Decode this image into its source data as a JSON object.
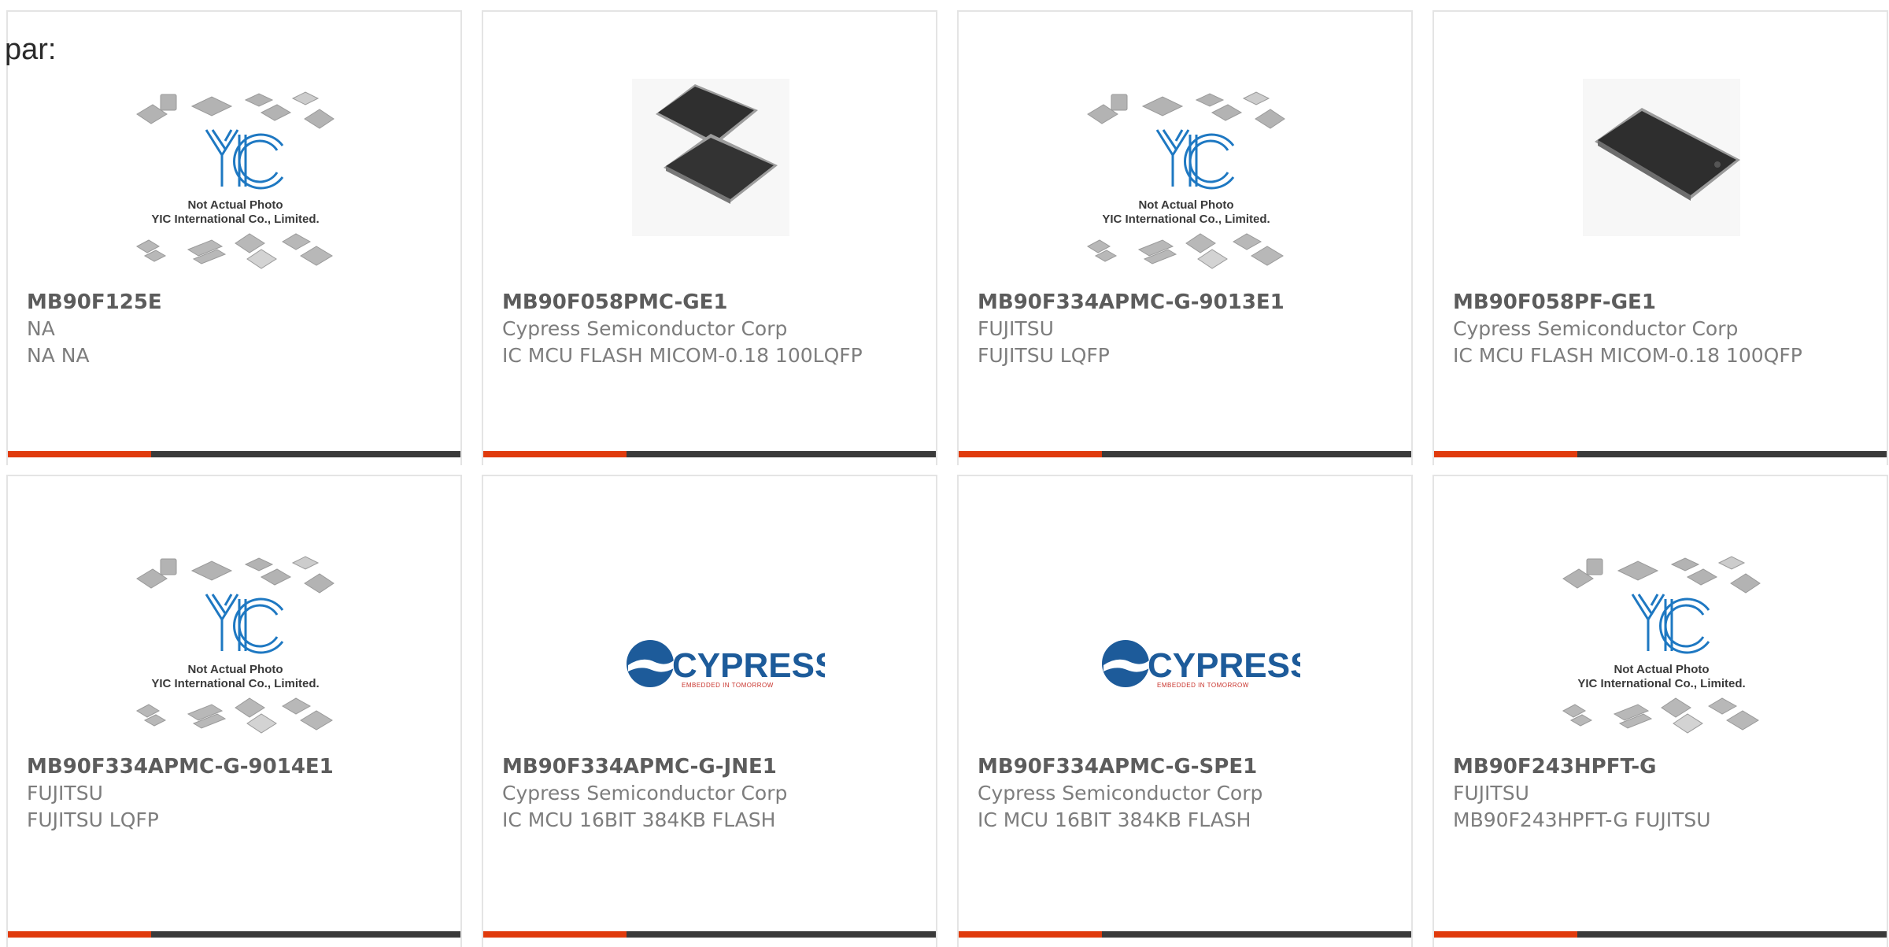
{
  "page": {
    "label": "par:"
  },
  "colors": {
    "accent": "#e03a0c",
    "bar_dark": "#3a3a3a",
    "border": "#e4e4e4"
  },
  "cards": [
    {
      "image": "yic-placeholder",
      "part": "MB90F125E",
      "manufacturer": "NA",
      "description": "NA NA",
      "note1": "Not Actual Photo",
      "note2": "YIC International Co., Limited."
    },
    {
      "image": "chip-pair-photo",
      "part": "MB90F058PMC-GE1",
      "manufacturer": "Cypress Semiconductor Corp",
      "description": "IC MCU FLASH MICOM-0.18 100LQFP"
    },
    {
      "image": "yic-placeholder",
      "part": "MB90F334APMC-G-9013E1",
      "manufacturer": "FUJITSU",
      "description": "FUJITSU LQFP",
      "note1": "Not Actual Photo",
      "note2": "YIC International Co., Limited."
    },
    {
      "image": "chip-single-photo",
      "part": "MB90F058PF-GE1",
      "manufacturer": "Cypress Semiconductor Corp",
      "description": "IC MCU FLASH MICOM-0.18 100QFP"
    },
    {
      "image": "yic-placeholder",
      "part": "MB90F334APMC-G-9014E1",
      "manufacturer": "FUJITSU",
      "description": "FUJITSU LQFP",
      "note1": "Not Actual Photo",
      "note2": "YIC International Co., Limited."
    },
    {
      "image": "cypress-logo",
      "part": "MB90F334APMC-G-JNE1",
      "manufacturer": "Cypress Semiconductor Corp",
      "description": "IC MCU 16BIT 384KB FLASH",
      "logo_word": "CYPRESS",
      "logo_tag": "EMBEDDED IN TOMORROW"
    },
    {
      "image": "cypress-logo",
      "part": "MB90F334APMC-G-SPE1",
      "manufacturer": "Cypress Semiconductor Corp",
      "description": "IC MCU 16BIT 384KB FLASH",
      "logo_word": "CYPRESS",
      "logo_tag": "EMBEDDED IN TOMORROW"
    },
    {
      "image": "yic-placeholder",
      "part": "MB90F243HPFT-G",
      "manufacturer": "FUJITSU",
      "description": "MB90F243HPFT-G FUJITSU",
      "note1": "Not Actual Photo",
      "note2": "YIC International Co., Limited."
    }
  ]
}
